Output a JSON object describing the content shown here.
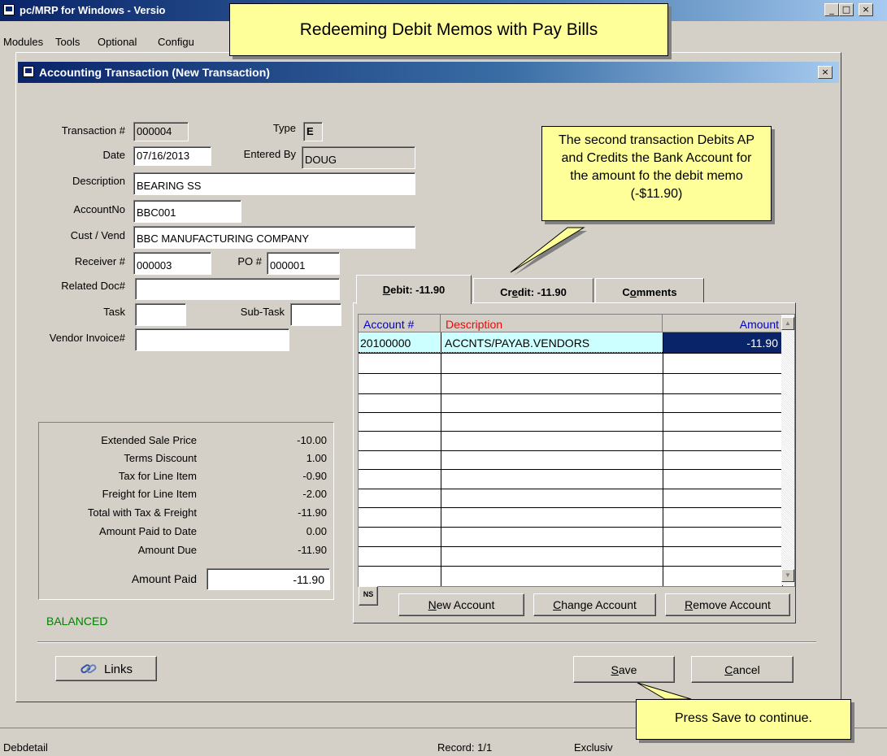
{
  "app": {
    "title": "pc/MRP for Windows - Versio",
    "menu": [
      "Modules",
      "Tools",
      "Optional",
      "Configu"
    ]
  },
  "window": {
    "title": "Accounting Transaction  (New Transaction)"
  },
  "form": {
    "transaction_label": "Transaction #",
    "transaction_value": "000004",
    "type_label": "Type",
    "type_value": "E",
    "date_label": "Date",
    "date_value": "07/16/2013",
    "entered_by_label": "Entered By",
    "entered_by_value": "DOUG",
    "description_label": "Description",
    "description_value": "BEARING SS",
    "accountno_label": "AccountNo",
    "accountno_value": "BBC001",
    "custvend_label": "Cust / Vend",
    "custvend_value": "BBC MANUFACTURING COMPANY",
    "receiver_label": "Receiver #",
    "receiver_value": "000003",
    "po_label": "PO #",
    "po_value": "000001",
    "related_label": "Related Doc#",
    "related_value": "",
    "task_label": "Task",
    "task_value": "",
    "subtask_label": "Sub-Task",
    "subtask_value": "",
    "vendor_invoice_label": "Vendor Invoice#",
    "vendor_invoice_value": ""
  },
  "summary": {
    "rows": [
      {
        "label": "Extended Sale Price",
        "value": "-10.00"
      },
      {
        "label": "Terms Discount",
        "value": "1.00"
      },
      {
        "label": "Tax for Line Item",
        "value": "-0.90"
      },
      {
        "label": "Freight for Line Item",
        "value": "-2.00"
      },
      {
        "label": "Total with Tax & Freight",
        "value": "-11.90"
      },
      {
        "label": "Amount Paid to Date",
        "value": "0.00"
      },
      {
        "label": "Amount Due",
        "value": "-11.90"
      }
    ],
    "amount_paid_label": "Amount Paid",
    "amount_paid_value": "-11.90",
    "status": "BALANCED",
    "status_color": "#008000"
  },
  "tabs": {
    "debit": {
      "prefix": "D",
      "rest": "ebit:  -11.90"
    },
    "credit": {
      "pre": "Cr",
      "ul": "e",
      "post": "dit:  -11.90"
    },
    "comments": {
      "pre": "C",
      "ul": "o",
      "post": "mments"
    }
  },
  "grid": {
    "headers": {
      "account": "Account #",
      "description": "Description",
      "amount": "Amount"
    },
    "header_colors": {
      "account": "#0000cc",
      "description": "#ff0000",
      "amount": "#0000cc"
    },
    "rows": [
      {
        "account": "20100000",
        "description": "ACCNTS/PAYAB.VENDORS",
        "amount": "-11.90"
      }
    ],
    "ns_label": "NS"
  },
  "buttons": {
    "new_account": {
      "ul": "N",
      "rest": "ew Account"
    },
    "change_account": {
      "ul": "C",
      "rest": "hange Account"
    },
    "remove_account": {
      "ul": "R",
      "rest": "emove Account"
    },
    "links": "Links",
    "save": {
      "ul": "S",
      "rest": "ave"
    },
    "cancel": {
      "ul": "C",
      "rest": "ancel"
    }
  },
  "callouts": {
    "banner": "Redeeming Debit Memos with Pay Bills",
    "tip": "The second transaction Debits AP and Credits the Bank Account for the amount fo the debit memo (-$11.90)",
    "save_tip": "Press Save to continue."
  },
  "status_bar": {
    "left": "Debdetail",
    "record": "Record: 1/1",
    "mode": "Exclusiv"
  }
}
